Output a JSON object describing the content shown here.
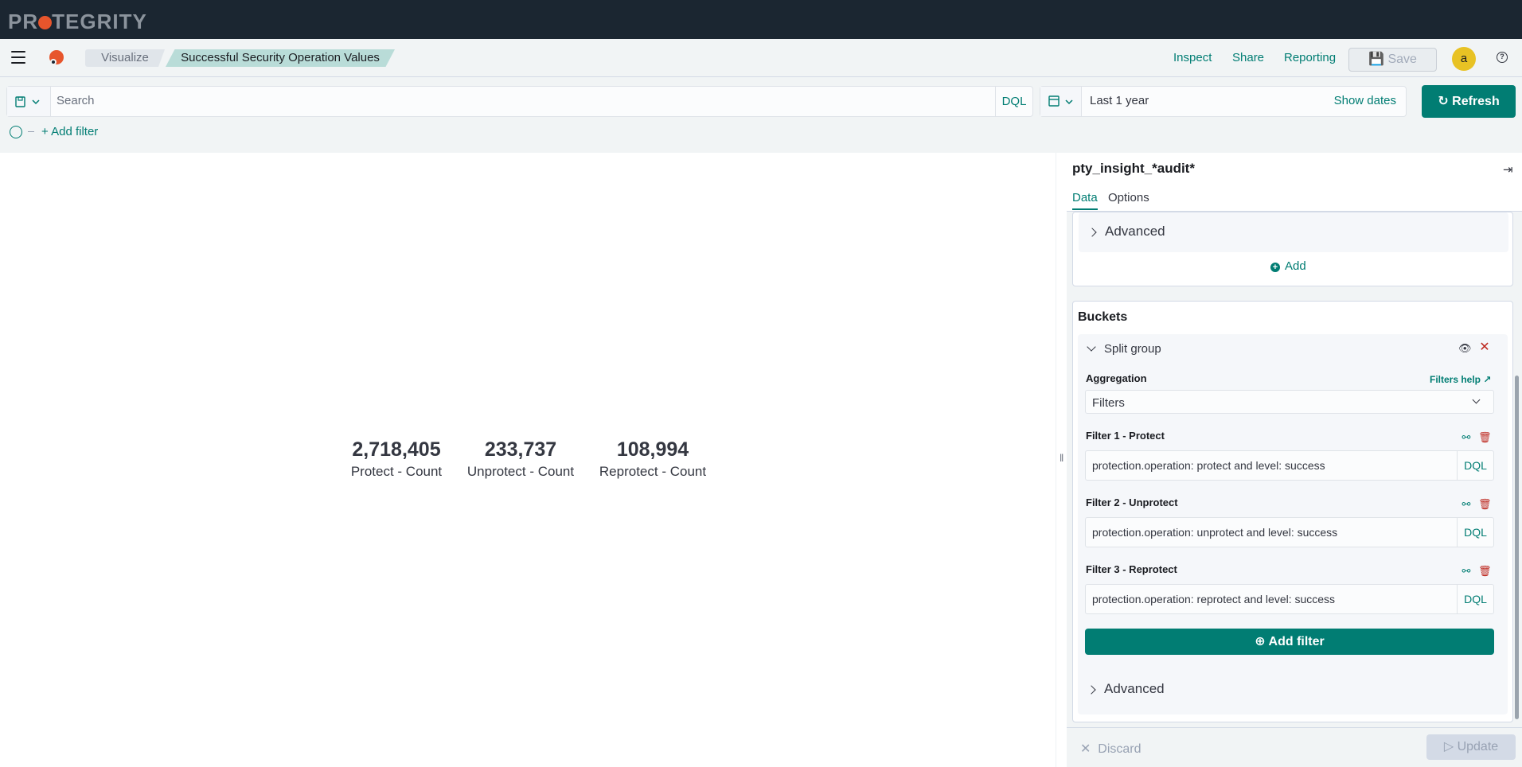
{
  "brand": {
    "name_pre": "PR",
    "name_post": "TEGRITY"
  },
  "nav": {
    "breadcrumbs": [
      "Visualize",
      "Successful Security Operation Values"
    ],
    "links": [
      "Inspect",
      "Share",
      "Reporting"
    ],
    "save_label": "Save",
    "avatar_letter": "a"
  },
  "query": {
    "search_placeholder": "Search",
    "language": "DQL",
    "time_range": "Last 1 year",
    "show_dates": "Show dates",
    "refresh_label": "Refresh",
    "add_filter": "+ Add filter"
  },
  "metrics": [
    {
      "value": "2,718,405",
      "label": "Protect - Count"
    },
    {
      "value": "233,737",
      "label": "Unprotect - Count"
    },
    {
      "value": "108,994",
      "label": "Reprotect - Count"
    }
  ],
  "sidebar": {
    "index_pattern": "pty_insight_*audit*",
    "tabs": [
      "Data",
      "Options"
    ],
    "metrics_advanced": "Advanced",
    "add_label": "Add",
    "buckets_title": "Buckets",
    "split_group": "Split group",
    "aggregation_label": "Aggregation",
    "filters_help": "Filters help",
    "aggregation_value": "Filters",
    "filters": [
      {
        "label": "Filter 1 - Protect",
        "query": "protection.operation: protect and level: success",
        "lang": "DQL"
      },
      {
        "label": "Filter 2 - Unprotect",
        "query": "protection.operation: unprotect  and level: success",
        "lang": "DQL"
      },
      {
        "label": "Filter 3 - Reprotect",
        "query": "protection.operation: reprotect  and level: success",
        "lang": "DQL"
      }
    ],
    "add_filter_button": "Add filter",
    "bucket_advanced": "Advanced",
    "discard_label": "Discard",
    "update_label": "Update"
  },
  "colors": {
    "accent": "#017d73",
    "header_bg": "#1b2631",
    "danger": "#bd271e",
    "brand_orange": "#e7552c"
  }
}
